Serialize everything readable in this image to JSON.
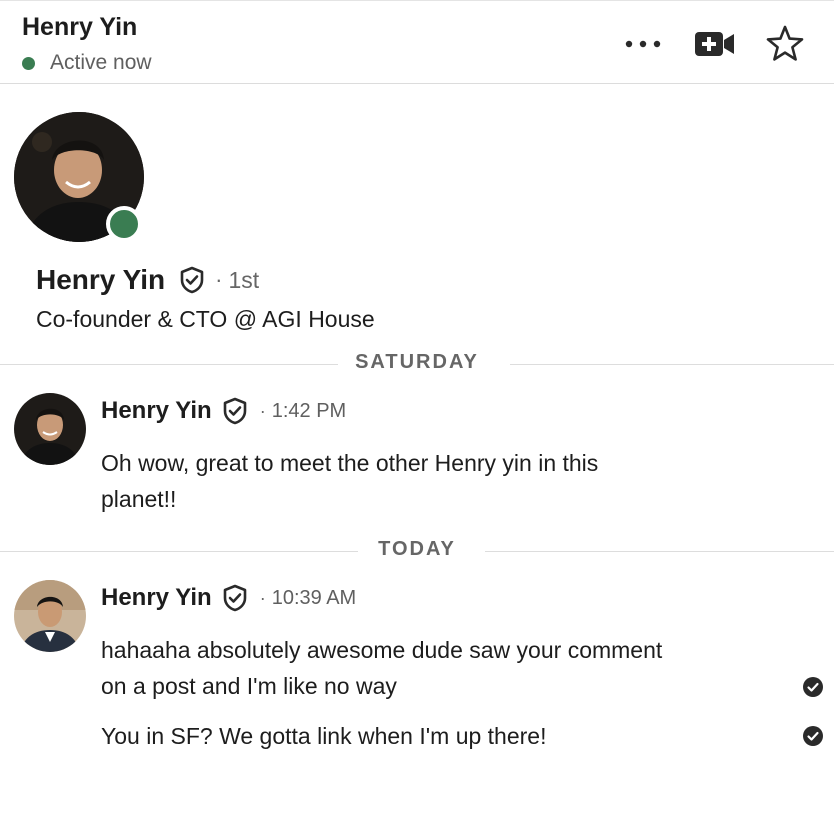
{
  "header": {
    "name": "Henry Yin",
    "status": "Active now",
    "icons": [
      "more-options-icon",
      "video-call-icon",
      "star-icon"
    ],
    "presence_color": "#3a7d52"
  },
  "profile": {
    "name": "Henry Yin",
    "separator": "·",
    "degree": "1st",
    "headline": "Co-founder & CTO @ AGI House",
    "icons": [
      "verified-shield-icon",
      "presence-indicator"
    ]
  },
  "dividers": {
    "saturday": "SATURDAY",
    "today": "TODAY"
  },
  "messages": [
    {
      "sender": "Henry Yin",
      "separator": "·",
      "time": "1:42 PM",
      "lines": [
        "Oh wow, great to meet the other Henry yin in this",
        "planet!!"
      ]
    },
    {
      "sender": "Henry Yin",
      "separator": "·",
      "time": "10:39 AM",
      "lines": [
        "hahaaha absolutely awesome dude saw your comment",
        "on a post and I'm like no way"
      ],
      "extra": "You in SF? We gotta link when I'm up there!",
      "read_receipt_icon": "read-receipt-icon"
    }
  ]
}
